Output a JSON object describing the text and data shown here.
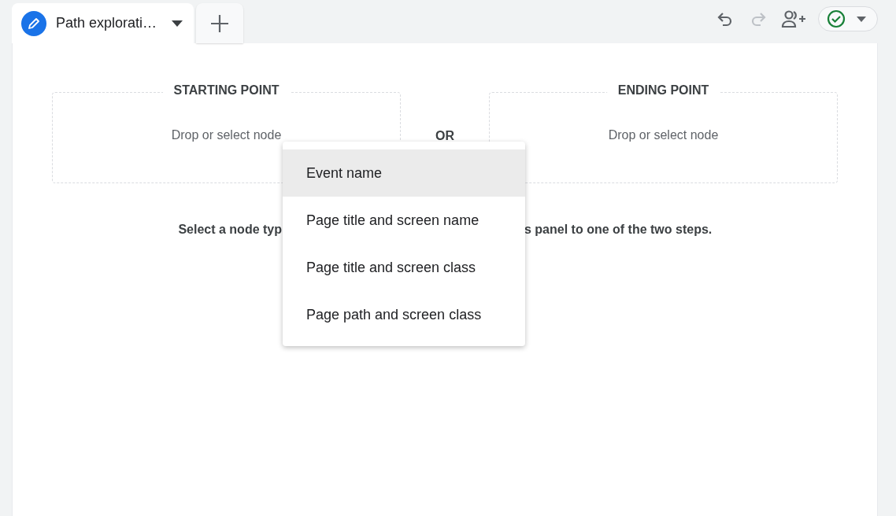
{
  "tabs": [
    {
      "label": "Path explorati…",
      "selected": true
    }
  ],
  "toolbar": {
    "undo_disabled": false,
    "redo_disabled": true,
    "status_ok": true
  },
  "steps": [
    {
      "title": "STARTING POINT",
      "hint": "Drop or select node"
    },
    {
      "title": "ENDING POINT",
      "hint": "Drop or select node"
    }
  ],
  "separator": "OR",
  "instruction": {
    "before": "Select a node typ",
    "after": "s panel to one of the two steps."
  },
  "menu": {
    "items": [
      {
        "label": "Event name",
        "selected": true
      },
      {
        "label": "Page title and screen name",
        "selected": false
      },
      {
        "label": "Page title and screen class",
        "selected": false
      },
      {
        "label": "Page path and screen class",
        "selected": false
      }
    ]
  }
}
